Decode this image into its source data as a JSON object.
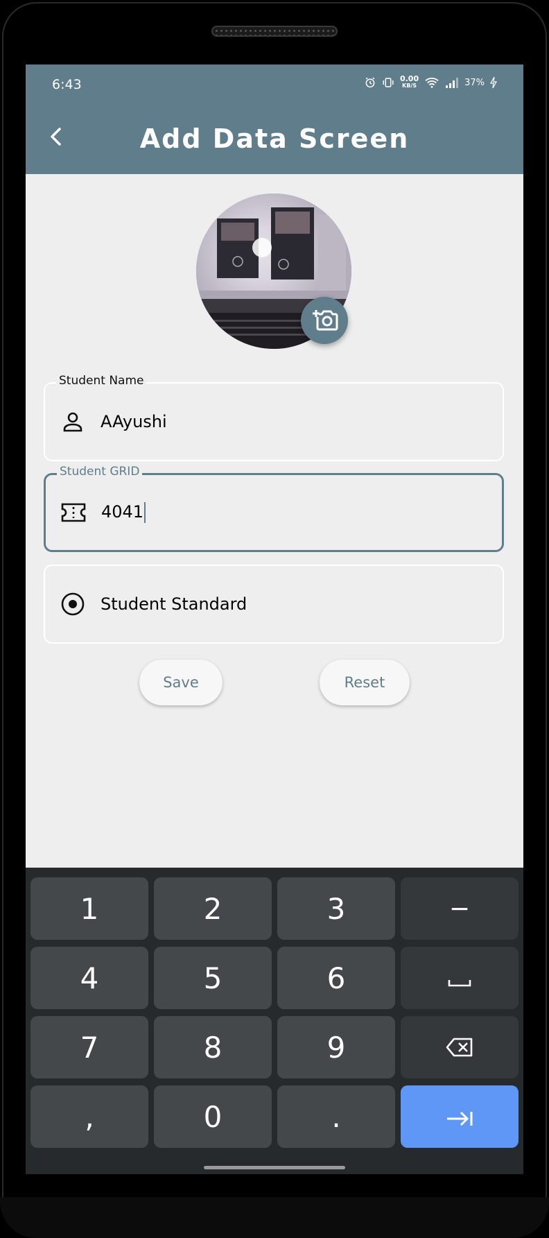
{
  "status_bar": {
    "time": "6:43",
    "speed_value": "0.00",
    "speed_unit": "KB/S",
    "battery": "37%"
  },
  "appbar": {
    "title": "Add Data Screen",
    "back_icon": "chevron-left-icon"
  },
  "avatar": {
    "camera_icon": "add-photo-icon"
  },
  "fields": {
    "name": {
      "label": "Student Name",
      "value": "AAyushi",
      "icon": "person-icon"
    },
    "grid": {
      "label": "Student GRID",
      "value": "4041",
      "icon": "ticket-icon"
    },
    "standard": {
      "value": "Student Standard",
      "icon": "radio-button-icon"
    }
  },
  "buttons": {
    "save": "Save",
    "reset": "Reset"
  },
  "keyboard": {
    "rows": [
      [
        "1",
        "2",
        "3",
        "−"
      ],
      [
        "4",
        "5",
        "6",
        "␣"
      ],
      [
        "7",
        "8",
        "9",
        "⌫"
      ],
      [
        ",",
        "0",
        ".",
        "⇥"
      ]
    ]
  },
  "colors": {
    "primary": "#607d8b",
    "background": "#eeeeee",
    "keyboard": "#262a2d",
    "enter_key": "#5e97f6"
  }
}
